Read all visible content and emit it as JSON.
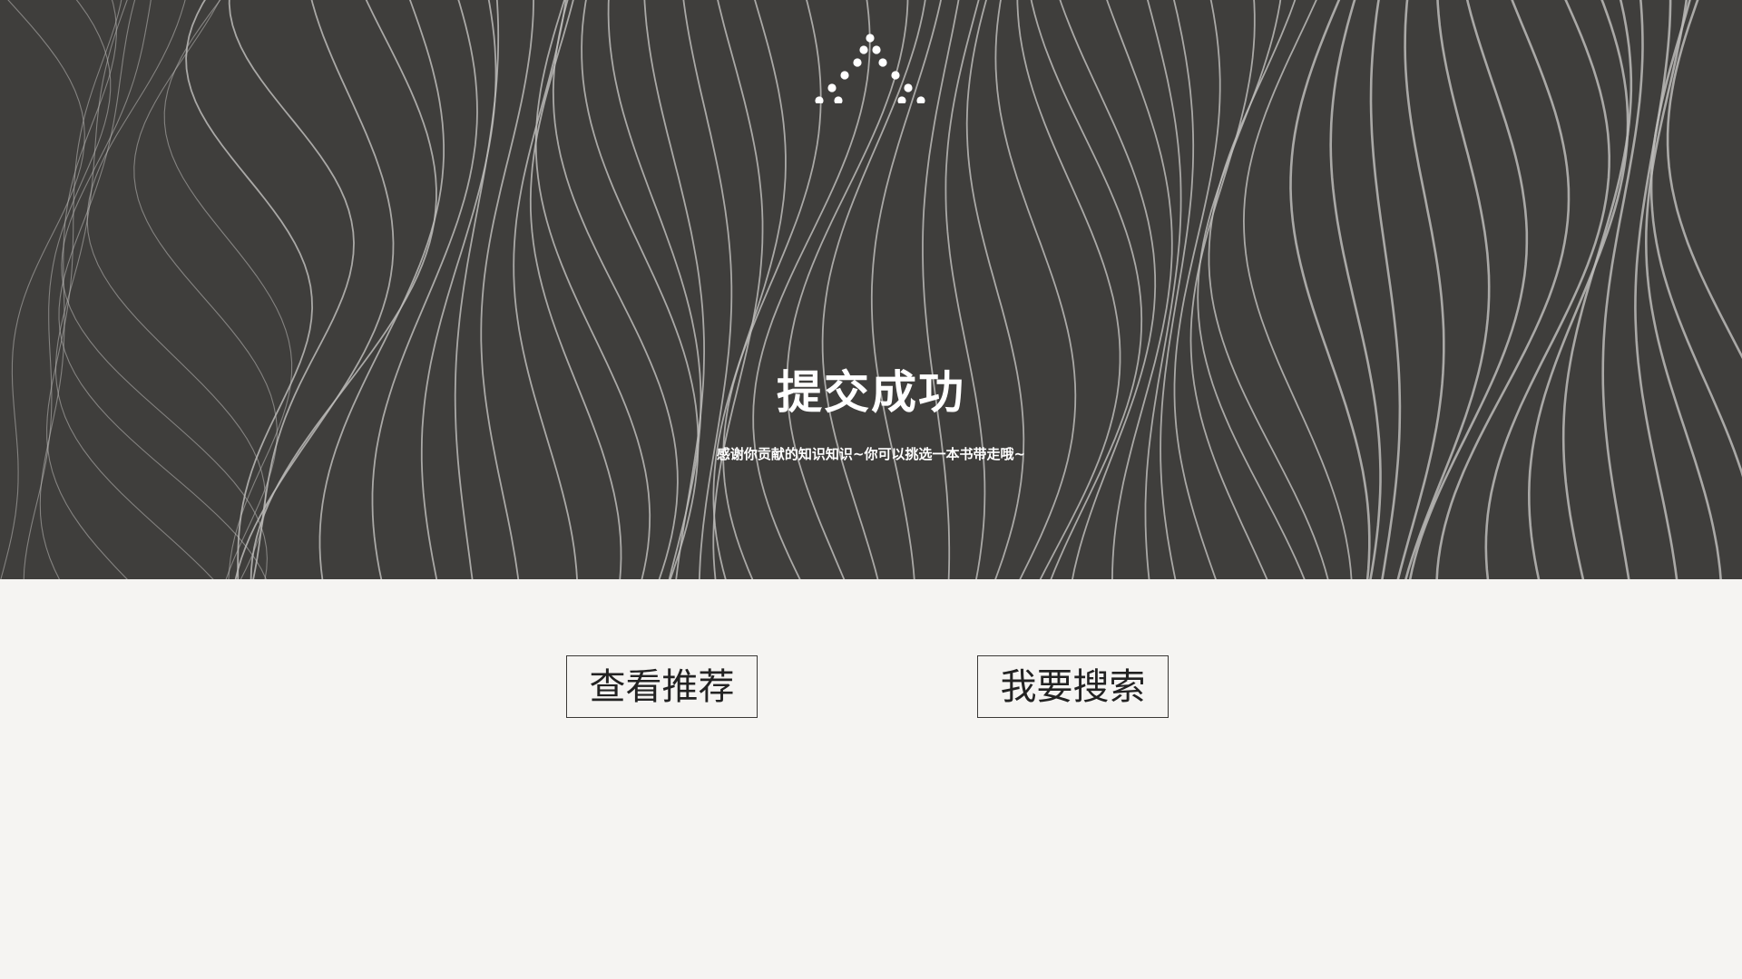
{
  "hero": {
    "title": "提交成功",
    "subtitle": "感谢你贡献的知识知识~你可以挑选一本书带走哦~",
    "background_color": "#3f3e3c",
    "line_color": "#bdbcba",
    "logo_icon": "mountain-dots-icon"
  },
  "actions": {
    "recommend_label": "查看推荐",
    "search_label": "我要搜索"
  },
  "colors": {
    "page_background": "#f5f4f2",
    "button_border": "#3a3836",
    "button_text": "#222222",
    "title_text": "#ffffff"
  }
}
